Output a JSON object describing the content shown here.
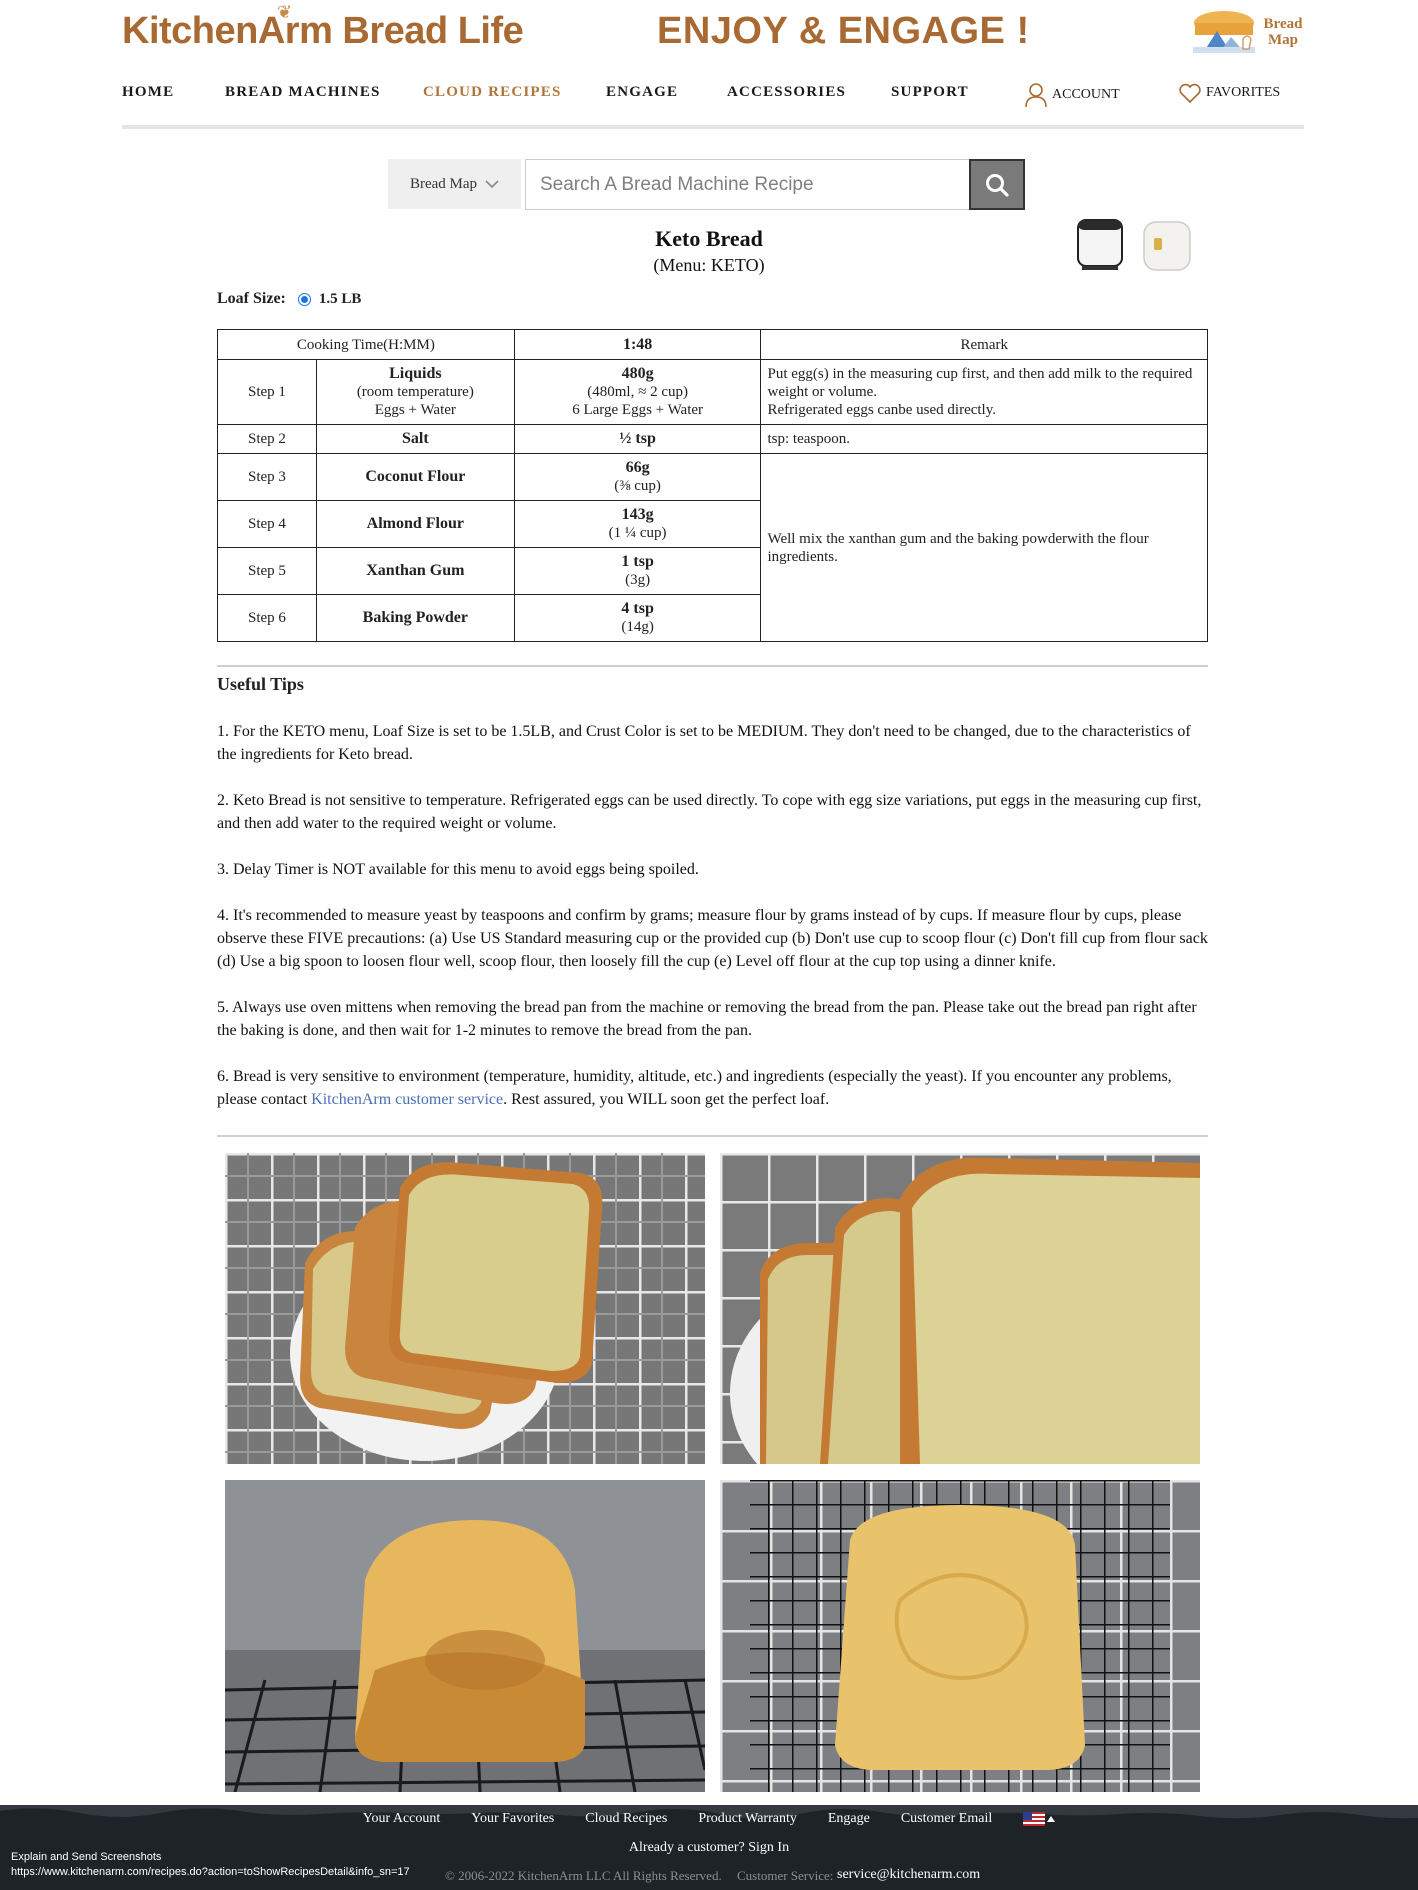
{
  "header": {
    "logo_text": "KitchenArm Bread Life",
    "slogan": "ENJOY & ENGAGE !",
    "bread_map_badge": "Bread Map",
    "brand_color": "#a86a32"
  },
  "nav": {
    "items": [
      "HOME",
      "BREAD MACHINES",
      "CLOUD RECIPES",
      "ENGAGE",
      "ACCESSORIES",
      "SUPPORT"
    ],
    "active": "CLOUD RECIPES",
    "account_label": "ACCOUNT",
    "favorites_label": "FAVORITES"
  },
  "search": {
    "select_label": "Bread Map",
    "placeholder": "Search A Bread Machine Recipe",
    "button_icon": "search-icon"
  },
  "recipe": {
    "title": "Keto Bread",
    "menu": "(Menu: KETO)",
    "loaf_size_label": "Loaf Size:",
    "loaf_size_option": "1.5 LB"
  },
  "table": {
    "cooking_time_label": "Cooking Time(H:MM)",
    "cooking_time_value": "1:48",
    "remark_header": "Remark",
    "steps": [
      {
        "step": "Step 1",
        "ingredient": "Liquids",
        "ingredient_note1": "(room temperature)",
        "ingredient_note2": "Eggs + Water",
        "amount": "480g",
        "amount_note1": "(480ml, ≈ 2 cup)",
        "amount_note2": "6 Large Eggs + Water"
      },
      {
        "step": "Step 2",
        "ingredient": "Salt",
        "amount": "½ tsp"
      },
      {
        "step": "Step 3",
        "ingredient": "Coconut Flour",
        "amount": "66g",
        "amount_note1": "(⅜ cup)"
      },
      {
        "step": "Step 4",
        "ingredient": "Almond Flour",
        "amount": "143g",
        "amount_note1": "(1 ¼ cup)"
      },
      {
        "step": "Step 5",
        "ingredient": "Xanthan Gum",
        "amount": "1 tsp",
        "amount_note1": "(3g)"
      },
      {
        "step": "Step 6",
        "ingredient": "Baking Powder",
        "amount": "4 tsp",
        "amount_note1": "(14g)"
      }
    ],
    "remarks": {
      "step1_line1": "Put egg(s) in the measuring cup first, and then add milk to the required weight or volume.",
      "step1_line2": "Refrigerated eggs canbe used directly.",
      "step2": "tsp: teaspoon.",
      "steps3_6": "Well mix the xanthan gum and the baking powderwith the flour ingredients."
    }
  },
  "tips": {
    "title": "Useful Tips",
    "items": [
      "1. For the KETO menu, Loaf Size is set to be 1.5LB, and Crust Color is set to be MEDIUM. They don't need to be changed, due to the characteristics of the ingredients for Keto bread.",
      "2. Keto Bread is not sensitive to temperature. Refrigerated eggs can be used directly. To cope with egg size variations, put eggs in the measuring cup first, and then add water to the required weight or volume.",
      "3. Delay Timer is NOT available for this menu to avoid eggs being spoiled.",
      "4. It's recommended to measure yeast by teaspoons and confirm by grams; measure flour by grams instead of by cups. If measure flour by cups, please observe these FIVE precautions: (a) Use US Standard measuring cup or the provided cup (b) Don't use cup to scoop flour (c) Don't fill cup from flour sack (d) Use a big spoon to loosen flour well, scoop flour, then loosely fill the cup (e) Level off flour at the cup top using a dinner knife.",
      "5. Always use oven mittens when removing the bread pan from the machine or removing the bread from the pan. Please take out the bread pan right after the baking is done, and then wait for 1-2 minutes to remove the bread from the pan."
    ],
    "item6_before": "6. Bread is very sensitive to environment (temperature, humidity, altitude, etc.) and ingredients (especially the yeast). If you encounter any problems, please contact ",
    "item6_link": "KitchenArm customer service",
    "item6_after": ". Rest assured, you WILL soon get the perfect loaf."
  },
  "footer": {
    "links": [
      "Your Account",
      "Your Favorites",
      "Cloud Recipes",
      "Product Warranty",
      "Engage",
      "Customer Email"
    ],
    "sign_in": "Already a customer? Sign In",
    "copyright": "© 2006-2022 KitchenArm LLC All Rights Reserved.",
    "service_label": "Customer Service:",
    "service_email": "service@kitchenarm.com"
  },
  "status": {
    "line1": "Explain and Send Screenshots",
    "line2": "https://www.kitchenarm.com/recipes.do?action=toShowRecipesDetail&info_sn=17"
  }
}
